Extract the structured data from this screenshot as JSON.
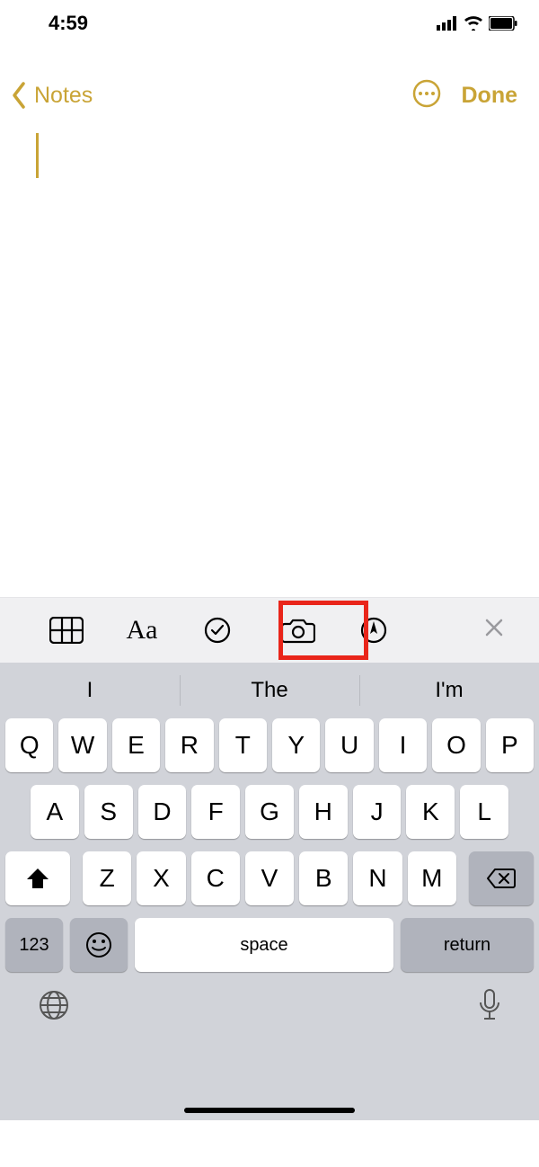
{
  "status": {
    "time": "4:59"
  },
  "nav": {
    "back_label": "Notes",
    "done_label": "Done"
  },
  "note": {
    "content": ""
  },
  "toolbar": {
    "format_label": "Aa"
  },
  "suggestions": [
    "I",
    "The",
    "I'm"
  ],
  "keyboard": {
    "row1": [
      "Q",
      "W",
      "E",
      "R",
      "T",
      "Y",
      "U",
      "I",
      "O",
      "P"
    ],
    "row2": [
      "A",
      "S",
      "D",
      "F",
      "G",
      "H",
      "J",
      "K",
      "L"
    ],
    "row3": [
      "Z",
      "X",
      "C",
      "V",
      "B",
      "N",
      "M"
    ],
    "numbers_label": "123",
    "space_label": "space",
    "return_label": "return"
  }
}
